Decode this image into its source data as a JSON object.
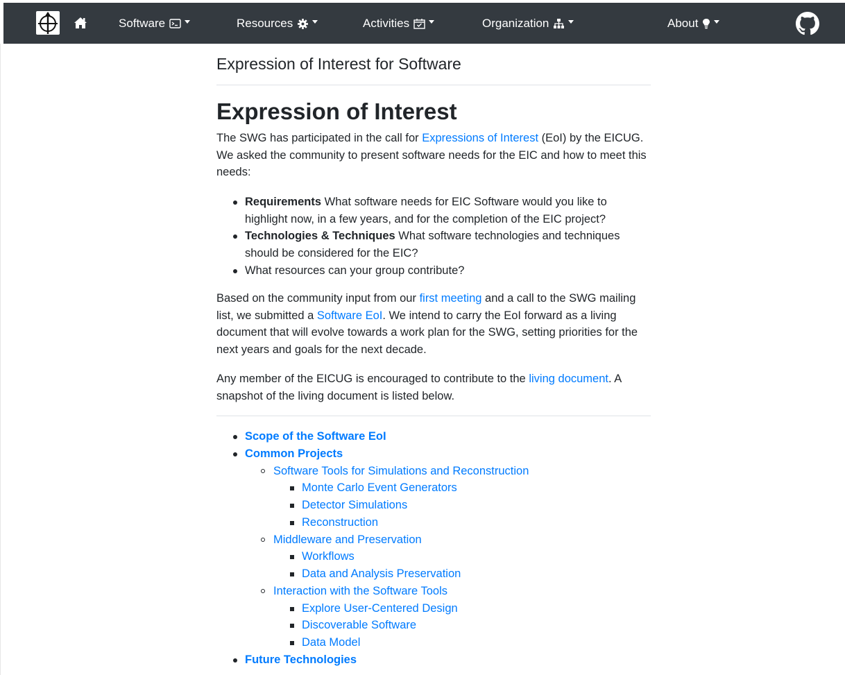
{
  "navbar": {
    "items": [
      {
        "label": "Software",
        "icon": "terminal-icon"
      },
      {
        "label": "Resources",
        "icon": "gear-icon"
      },
      {
        "label": "Activities",
        "icon": "calendar-check-icon"
      },
      {
        "label": "Organization",
        "icon": "sitemap-icon"
      },
      {
        "label": "About",
        "icon": "lightbulb-icon"
      }
    ]
  },
  "page": {
    "title": "Expression of Interest for Software",
    "heading": "Expression of Interest",
    "intro": {
      "before": "The SWG has participated in the call for ",
      "link": "Expressions of Interest",
      "after": " (EoI) by the EICUG. We asked the community to present software needs for the EIC and how to meet this needs:"
    },
    "requirements": [
      {
        "bold": "Requirements",
        "text": " What software needs for EIC Software would you like to highlight now, in a few years, and for the completion of the EIC project?"
      },
      {
        "bold": "Technologies & Techniques",
        "text": " What software technologies and techniques should be considered for the EIC?"
      },
      {
        "bold": "",
        "text": "What resources can your group contribute?"
      }
    ],
    "para2": {
      "t1": "Based on the community input from our ",
      "link1": "first meeting",
      "t2": " and a call to the SWG mailing list, we submitted a ",
      "link2": "Software EoI",
      "t3": ". We intend to carry the EoI forward as a living document that will evolve towards a work plan for the SWG, setting priorities for the next years and goals for the next decade."
    },
    "para3": {
      "t1": "Any member of the EICUG is encouraged to contribute to the ",
      "link": "living document",
      "t2": ". A snapshot of the living document is listed below."
    }
  },
  "toc": [
    {
      "level": 1,
      "label": "Scope of the Software EoI"
    },
    {
      "level": 1,
      "label": "Common Projects"
    },
    {
      "level": 2,
      "label": "Software Tools for Simulations and Reconstruction"
    },
    {
      "level": 3,
      "label": "Monte Carlo Event Generators"
    },
    {
      "level": 3,
      "label": "Detector Simulations"
    },
    {
      "level": 3,
      "label": "Reconstruction"
    },
    {
      "level": 2,
      "label": "Middleware and Preservation"
    },
    {
      "level": 3,
      "label": "Workflows"
    },
    {
      "level": 3,
      "label": "Data and Analysis Preservation"
    },
    {
      "level": 2,
      "label": "Interaction with the Software Tools"
    },
    {
      "level": 3,
      "label": "Explore User-Centered Design"
    },
    {
      "level": 3,
      "label": "Discoverable Software"
    },
    {
      "level": 3,
      "label": "Data Model"
    },
    {
      "level": 1,
      "label": "Future Technologies"
    }
  ]
}
